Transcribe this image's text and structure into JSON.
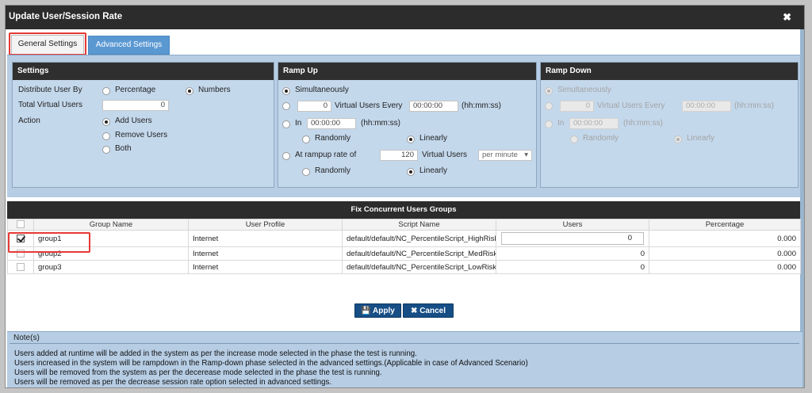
{
  "dialog": {
    "title": "Update User/Session Rate",
    "close_glyph": "✖"
  },
  "tabs": [
    {
      "label": "General Settings",
      "active": true
    },
    {
      "label": "Advanced Settings",
      "active": false
    }
  ],
  "settings": {
    "header": "Settings",
    "distribute_label": "Distribute User By",
    "distribute_options": [
      "Percentage",
      "Numbers"
    ],
    "distribute_selected": "Numbers",
    "total_label": "Total Virtual Users",
    "total_value": "0",
    "action_label": "Action",
    "action_options": [
      "Add Users",
      "Remove Users",
      "Both"
    ],
    "action_selected": "Add Users"
  },
  "ramp_up": {
    "header": "Ramp Up",
    "simultaneously": "Simultaneously",
    "users_value": "0",
    "users_every_label": "Virtual Users Every",
    "every_time": "00:00:00",
    "hhmmss": "(hh:mm:ss)",
    "in_label": "In",
    "in_time": "00:00:00",
    "randomly": "Randomly",
    "linearly": "Linearly",
    "rampup_rate_label": "At rampup rate of",
    "rate_value": "120",
    "virtual_users": "Virtual Users",
    "per_option": "per minute"
  },
  "ramp_down": {
    "header": "Ramp Down",
    "simultaneously": "Simultaneously",
    "users_value": "0",
    "users_every_label": "Virtual Users Every",
    "every_time": "00:00:00",
    "hhmmss": "(hh:mm:ss)",
    "in_label": "In",
    "in_time": "00:00:00",
    "randomly": "Randomly",
    "linearly": "Linearly"
  },
  "grid": {
    "title": "Fix Concurrent Users Groups",
    "columns": [
      "Group Name",
      "User Profile",
      "Script Name",
      "Users",
      "Percentage"
    ],
    "rows": [
      {
        "checked": true,
        "group": "group1",
        "profile": "Internet",
        "script": "default/default/NC_PercentileScript_HighRisk",
        "users": "0",
        "percentage": "0.000"
      },
      {
        "checked": false,
        "group": "group2",
        "profile": "Internet",
        "script": "default/default/NC_PercentileScript_MedRisk",
        "users": "0",
        "percentage": "0.000"
      },
      {
        "checked": false,
        "group": "group3",
        "profile": "Internet",
        "script": "default/default/NC_PercentileScript_LowRisk",
        "users": "0",
        "percentage": "0.000"
      }
    ]
  },
  "buttons": {
    "apply": "Apply",
    "cancel": "Cancel"
  },
  "notes": {
    "legend": "Note(s)",
    "lines": [
      "Users added at runtime will be added in the system as per the increase mode selected in the phase the test is running.",
      "Users increased in the system will be rampdown in the Ramp-down phase selected in the advanced settings.(Applicable in case of Advanced Scenario)",
      "Users will be removed from the system as per the decerease mode selected in the phase the test is running.",
      "Users will be removed as per the decrease session rate option selected in advanced settings."
    ]
  },
  "colors": {
    "title_bar": "#2c2c2c",
    "panel_bg": "#c4d8ec",
    "active_tab": "#5a98d2",
    "button": "#164e85",
    "highlight": "#e53935"
  }
}
